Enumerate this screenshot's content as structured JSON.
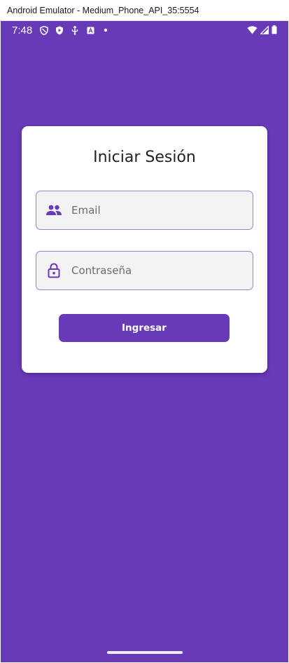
{
  "window": {
    "title": "Android Emulator - Medium_Phone_API_35:5554"
  },
  "status_bar": {
    "time": "7:48",
    "left_icons": [
      "shield-icon",
      "play-protect-icon",
      "usb-debug-icon",
      "app-notification-icon",
      "dot-icon"
    ],
    "right_icons": [
      "wifi-icon",
      "cell-signal-icon",
      "battery-icon"
    ]
  },
  "login": {
    "title": "Iniciar Sesión",
    "email_placeholder": "Email",
    "password_placeholder": "Contraseña",
    "submit_label": "Ingresar"
  },
  "colors": {
    "primary": "#673ab7",
    "field_border": "#9b80d1",
    "field_fill": "#f4f3f4",
    "card": "#ffffff"
  }
}
